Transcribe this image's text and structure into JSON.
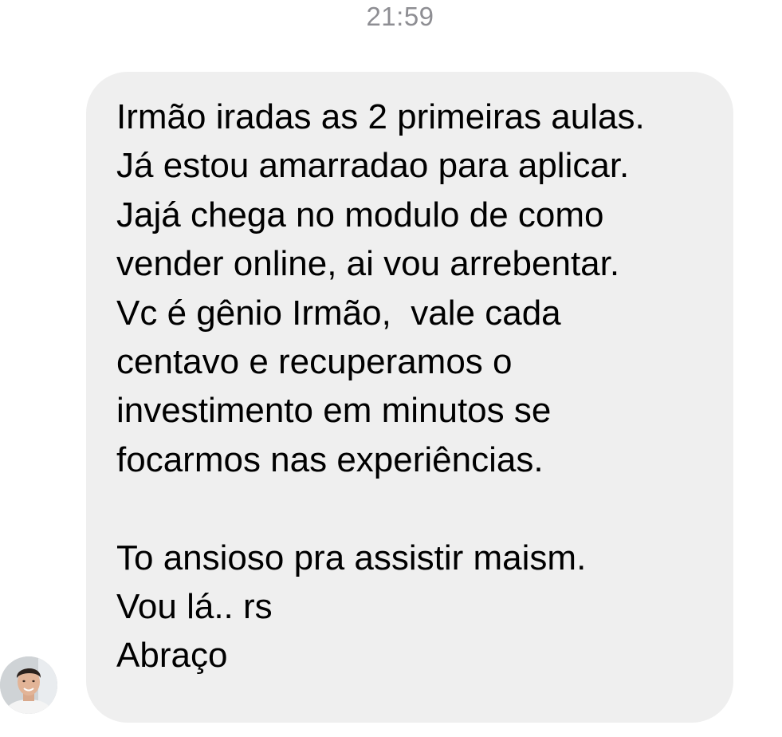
{
  "chat": {
    "timestamp": "21:59",
    "sender_avatar_icon": "user-avatar-icon",
    "message": {
      "lines": [
        "Irmão iradas as 2 primeiras aulas.",
        "Já estou amarradao para aplicar.",
        "Jajá chega no modulo de como",
        "vender online, ai vou arrebentar.",
        "Vc é gênio Irmão,  vale cada",
        "centavo e recuperamos o",
        "investimento em minutos se",
        "focarmos nas experiências.",
        "",
        "To ansioso pra assistir maism.",
        "Vou lá.. rs",
        "Abraço"
      ]
    }
  },
  "colors": {
    "background": "#ffffff",
    "bubble": "#efefef",
    "timestamp": "#8e8e93",
    "text": "#000000"
  }
}
